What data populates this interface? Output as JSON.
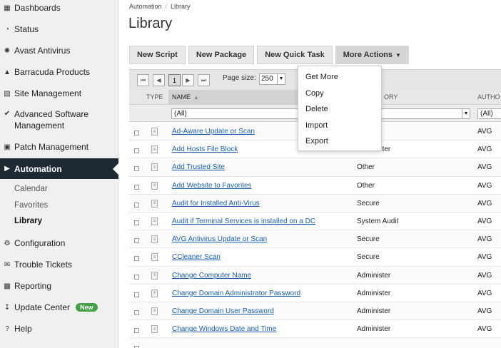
{
  "sidebar": {
    "items": [
      {
        "label": "Dashboards",
        "icon": "dashboard-icon"
      },
      {
        "label": "Status",
        "icon": "gauge-icon"
      },
      {
        "label": "Avast Antivirus",
        "icon": "avast-icon"
      },
      {
        "label": "Barracuda Products",
        "icon": "barracuda-icon"
      },
      {
        "label": "Site Management",
        "icon": "building-icon"
      },
      {
        "label": "Advanced Software Management",
        "icon": "check-circle-icon"
      },
      {
        "label": "Patch Management",
        "icon": "patch-icon"
      },
      {
        "label": "Automation",
        "icon": "play-circle-icon"
      },
      {
        "label": "Configuration",
        "icon": "gears-icon"
      },
      {
        "label": "Trouble Tickets",
        "icon": "ticket-icon"
      },
      {
        "label": "Reporting",
        "icon": "bar-chart-icon"
      },
      {
        "label": "Update Center",
        "icon": "download-icon"
      },
      {
        "label": "Help",
        "icon": "question-circle-icon"
      }
    ],
    "automation_sub": [
      "Calendar",
      "Favorites",
      "Library"
    ],
    "update_center_badge": "New",
    "active_color": "#1e2a33",
    "badge_color": "#43a047"
  },
  "breadcrumb": {
    "parent": "Automation",
    "current": "Library"
  },
  "page_title": "Library",
  "toolbar": {
    "new_script": "New Script",
    "new_package": "New Package",
    "new_quick_task": "New Quick Task",
    "more_actions": "More Actions"
  },
  "more_actions_menu": [
    "Get More",
    "Copy",
    "Delete",
    "Import",
    "Export"
  ],
  "grid": {
    "page_current": "1",
    "page_size_label": "Page size:",
    "page_size": "250",
    "columns": {
      "type": "TYPE",
      "name": "NAME",
      "category": "ORY",
      "author": "AUTHO"
    },
    "filters": {
      "name": "(All)",
      "author": "(All)"
    },
    "rows": [
      {
        "name": "Ad-Aware Update or Scan",
        "category": "",
        "author": "AVG"
      },
      {
        "name": "Add Hosts File Block",
        "category": "Administer",
        "author": "AVG"
      },
      {
        "name": "Add Trusted Site",
        "category": "Other",
        "author": "AVG"
      },
      {
        "name": "Add Website to Favorites",
        "category": "Other",
        "author": "AVG"
      },
      {
        "name": "Audit for Installed Anti-Virus",
        "category": "Secure",
        "author": "AVG"
      },
      {
        "name": "Audit if Terminal Services is installed on a DC",
        "category": "System Audit",
        "author": "AVG"
      },
      {
        "name": "AVG Antivirus Update or Scan",
        "category": "Secure",
        "author": "AVG"
      },
      {
        "name": "CCleaner Scan",
        "category": "Secure",
        "author": "AVG"
      },
      {
        "name": "Change Computer Name",
        "category": "Administer",
        "author": "AVG"
      },
      {
        "name": "Change Domain Administrator Password",
        "category": "Administer",
        "author": "AVG"
      },
      {
        "name": "Change Domain User Password",
        "category": "Administer",
        "author": "AVG"
      },
      {
        "name": "Change Windows Date and Time",
        "category": "Administer",
        "author": "AVG"
      },
      {
        "name": "",
        "category": "",
        "author": ""
      }
    ],
    "link_color": "#1a5fb4"
  }
}
